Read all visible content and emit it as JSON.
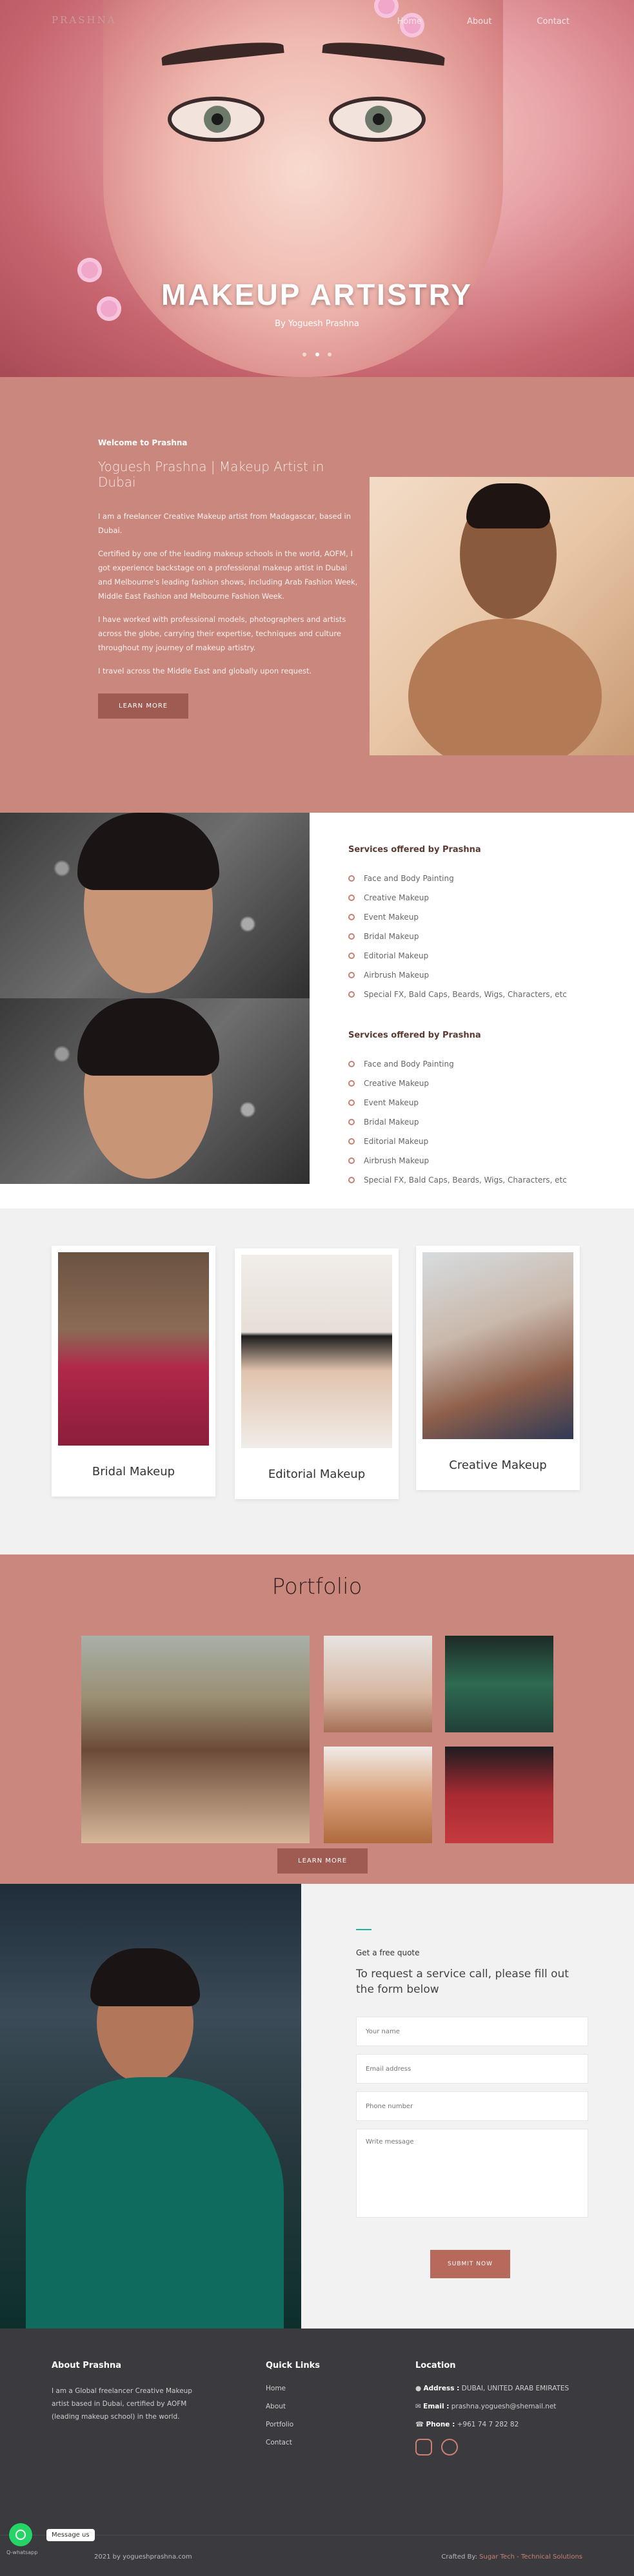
{
  "nav": {
    "brand": "PRASHNA",
    "links": [
      "Home",
      "About",
      "Contact"
    ]
  },
  "hero": {
    "title": "MAKEUP ARTISTRY",
    "subtitle": "By Yoguesh Prashna",
    "slides": 3,
    "active_slide": 1
  },
  "welcome": {
    "label": "Welcome to Prashna",
    "title": "Yoguesh Prashna | Makeup Artist in Dubai",
    "paragraphs": [
      "I am a freelancer Creative Makeup artist from Madagascar, based in Dubai.",
      "Certified by one of the leading makeup schools in the world, AOFM, I got experience backstage on a professional makeup artist in Dubai and Melbourne's leading fashion shows, including Arab Fashion Week, Middle East Fashion and Melbourne Fashion Week.",
      "I have worked with professional models, photographers and artists across the globe, carrying their expertise, techniques and culture throughout my journey of makeup artistry.",
      "I travel across the Middle East and globally upon request."
    ],
    "button": "LEARN MORE"
  },
  "services": {
    "title": "Services offered by Prashna",
    "items": [
      "Face and Body Painting",
      "Creative Makeup",
      "Event Makeup",
      "Bridal Makeup",
      "Editorial Makeup",
      "Airbrush Makeup",
      "Special FX, Bald Caps, Beards, Wigs, Characters, etc"
    ]
  },
  "cards": [
    {
      "label": "Bridal Makeup"
    },
    {
      "label": "Editorial Makeup"
    },
    {
      "label": "Creative Makeup"
    }
  ],
  "portfolio": {
    "title": "Portfolio",
    "button": "LEARN MORE"
  },
  "quote": {
    "label": "Get a free quote",
    "title": "To request a service call, please fill out the form below",
    "placeholders": {
      "name": "Your name",
      "email": "Email address",
      "phone": "Phone number",
      "message": "Write message"
    },
    "submit": "SUBMIT NOW"
  },
  "footer": {
    "about_title": "About Prashna",
    "about_text": "I am a Global freelancer Creative Makeup artist based in Dubai, certified by AOFM (leading makeup school) in the world.",
    "links_title": "Quick Links",
    "links": [
      "Home",
      "About",
      "Portfolio",
      "Contact"
    ],
    "location_title": "Location",
    "address_label": "Address :",
    "address": "DUBAI, UNITED ARAB EMIRATES",
    "email_label": "Email :",
    "email": "prashna.yoguesh@shemail.net",
    "phone_label": "Phone :",
    "phone": "+961 74 7 282 82",
    "copyright": "2021 by yogueshprashna.com",
    "crafted_prefix": "Crafted By:",
    "crafted_by": "Sugar Tech - Technical Solutions"
  },
  "whatsapp": {
    "bubble": "Message us",
    "caption": "Q-whatsapp"
  },
  "colors": {
    "accent": "#c9877d",
    "button": "#9f5b51",
    "footer": "#3a3a3f",
    "teal": "#1bb39a"
  }
}
